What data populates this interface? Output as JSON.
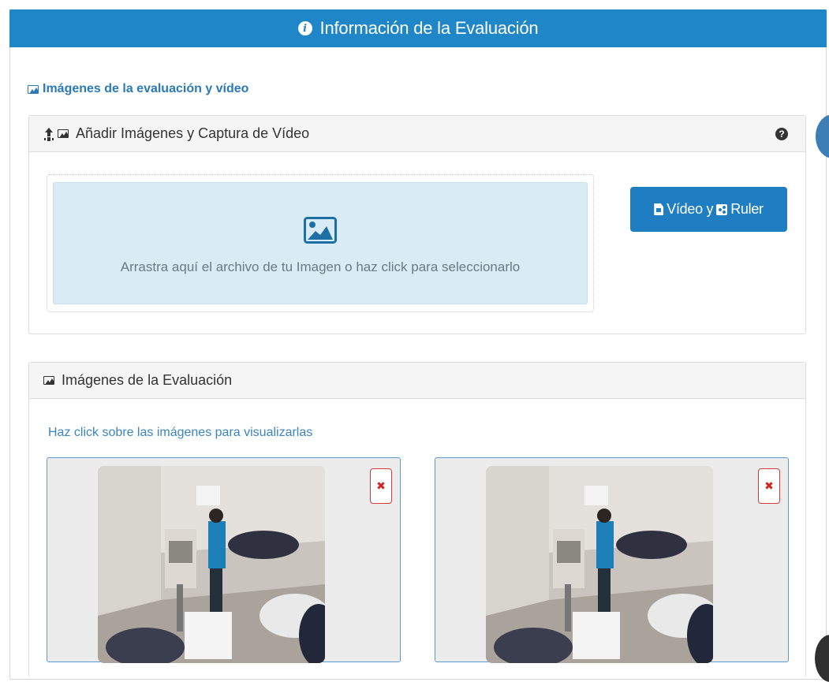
{
  "header": {
    "title": "Información de la Evaluación",
    "info_icon": "info-circle-icon"
  },
  "section": {
    "title": "Imágenes de la evaluación y vídeo"
  },
  "upload_panel": {
    "title": "Añadir Imágenes y Captura de Vídeo",
    "dropzone_text": "Arrastra aquí el archivo de tu Imagen o haz click para seleccionarlo",
    "video_button": {
      "part1": "Vídeo y",
      "part2": "Ruler"
    }
  },
  "images_panel": {
    "title": "Imágenes de la Evaluación",
    "hint": "Haz click sobre las imágenes para visualizarlas",
    "images": [
      {
        "delete_label": "✖"
      },
      {
        "delete_label": "✖"
      }
    ]
  },
  "colors": {
    "header_blue": "#1f86c7",
    "button_blue": "#1f7ec2",
    "link_blue": "#2a7ab8",
    "dropzone_bg": "#d9ebf5",
    "delete_red": "#d12525"
  }
}
